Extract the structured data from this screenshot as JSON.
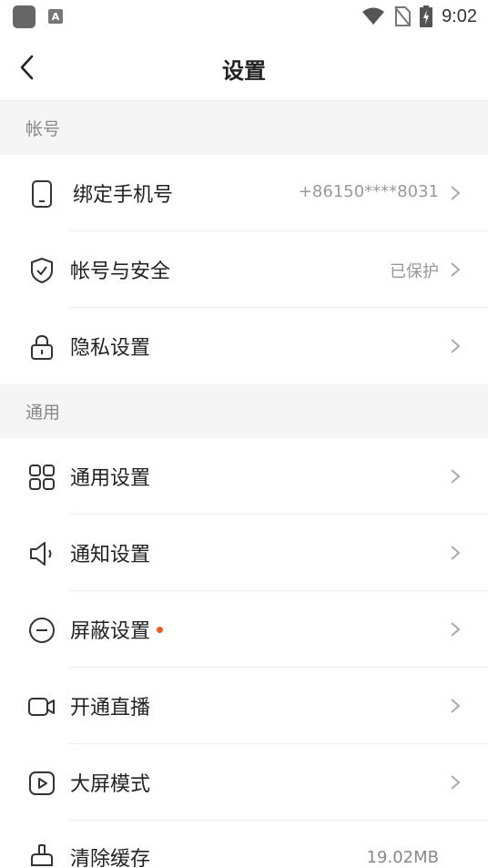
{
  "status": {
    "time": "9:02",
    "notif_letter": "A"
  },
  "nav": {
    "title": "设置"
  },
  "sections": {
    "account": "帐号",
    "general": "通用"
  },
  "rows": {
    "bind_phone": {
      "label": "绑定手机号",
      "value": "+86150****8031",
      "icon": "phone-icon"
    },
    "account_security": {
      "label": "帐号与安全",
      "value": "已保护",
      "icon": "shield-icon"
    },
    "privacy": {
      "label": "隐私设置",
      "icon": "lock-icon"
    },
    "general_settings": {
      "label": "通用设置",
      "icon": "grid-icon"
    },
    "notification": {
      "label": "通知设置",
      "icon": "speaker-icon"
    },
    "block": {
      "label": "屏蔽设置",
      "icon": "minus-circle-icon",
      "has_red_dot": true
    },
    "live": {
      "label": "开通直播",
      "icon": "video-camera-icon"
    },
    "big_screen": {
      "label": "大屏模式",
      "icon": "play-box-icon"
    },
    "clear_cache": {
      "label": "清除缓存",
      "value": "19.02MB",
      "icon": "broom-icon"
    }
  },
  "colors": {
    "accent_dot": "#f35a1a",
    "section_bg": "#f5f5f5",
    "muted_text": "#999999"
  }
}
